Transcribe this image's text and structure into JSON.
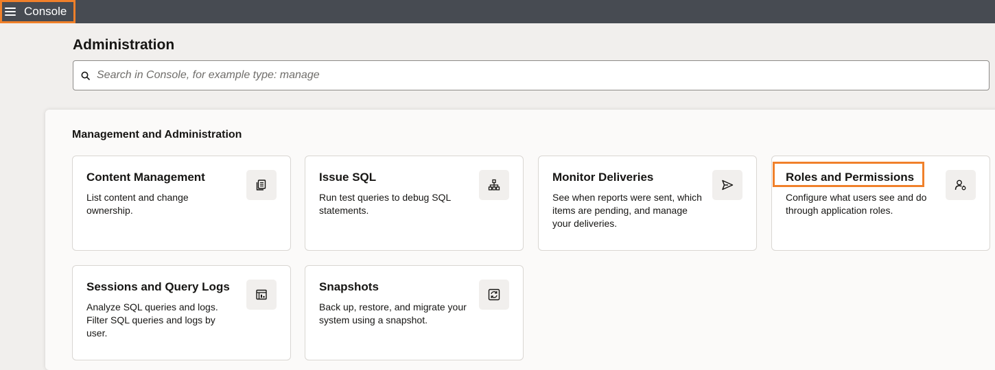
{
  "app": {
    "title": "Console"
  },
  "header": {
    "page_title": "Administration"
  },
  "search": {
    "placeholder": "Search in Console, for example type: manage"
  },
  "section": {
    "title": "Management and Administration",
    "cards": [
      {
        "title": "Content Management",
        "description": "List content and change ownership.",
        "icon": "documents-icon"
      },
      {
        "title": "Issue SQL",
        "description": "Run test queries to debug SQL statements.",
        "icon": "hierarchy-icon"
      },
      {
        "title": "Monitor Deliveries",
        "description": "See when reports were sent, which items are pending, and manage your deliveries.",
        "icon": "send-icon"
      },
      {
        "title": "Roles and Permissions",
        "description": "Configure what users see and do through application roles.",
        "icon": "user-settings-icon"
      },
      {
        "title": "Sessions and Query Logs",
        "description": "Analyze SQL queries and logs. Filter SQL queries and logs by user.",
        "icon": "report-log-icon"
      },
      {
        "title": "Snapshots",
        "description": "Back up, restore, and migrate your system using a snapshot.",
        "icon": "snapshot-icon"
      }
    ]
  },
  "colors": {
    "topbar": "#474b52",
    "highlight": "#f0802a",
    "background": "#f1efed"
  }
}
